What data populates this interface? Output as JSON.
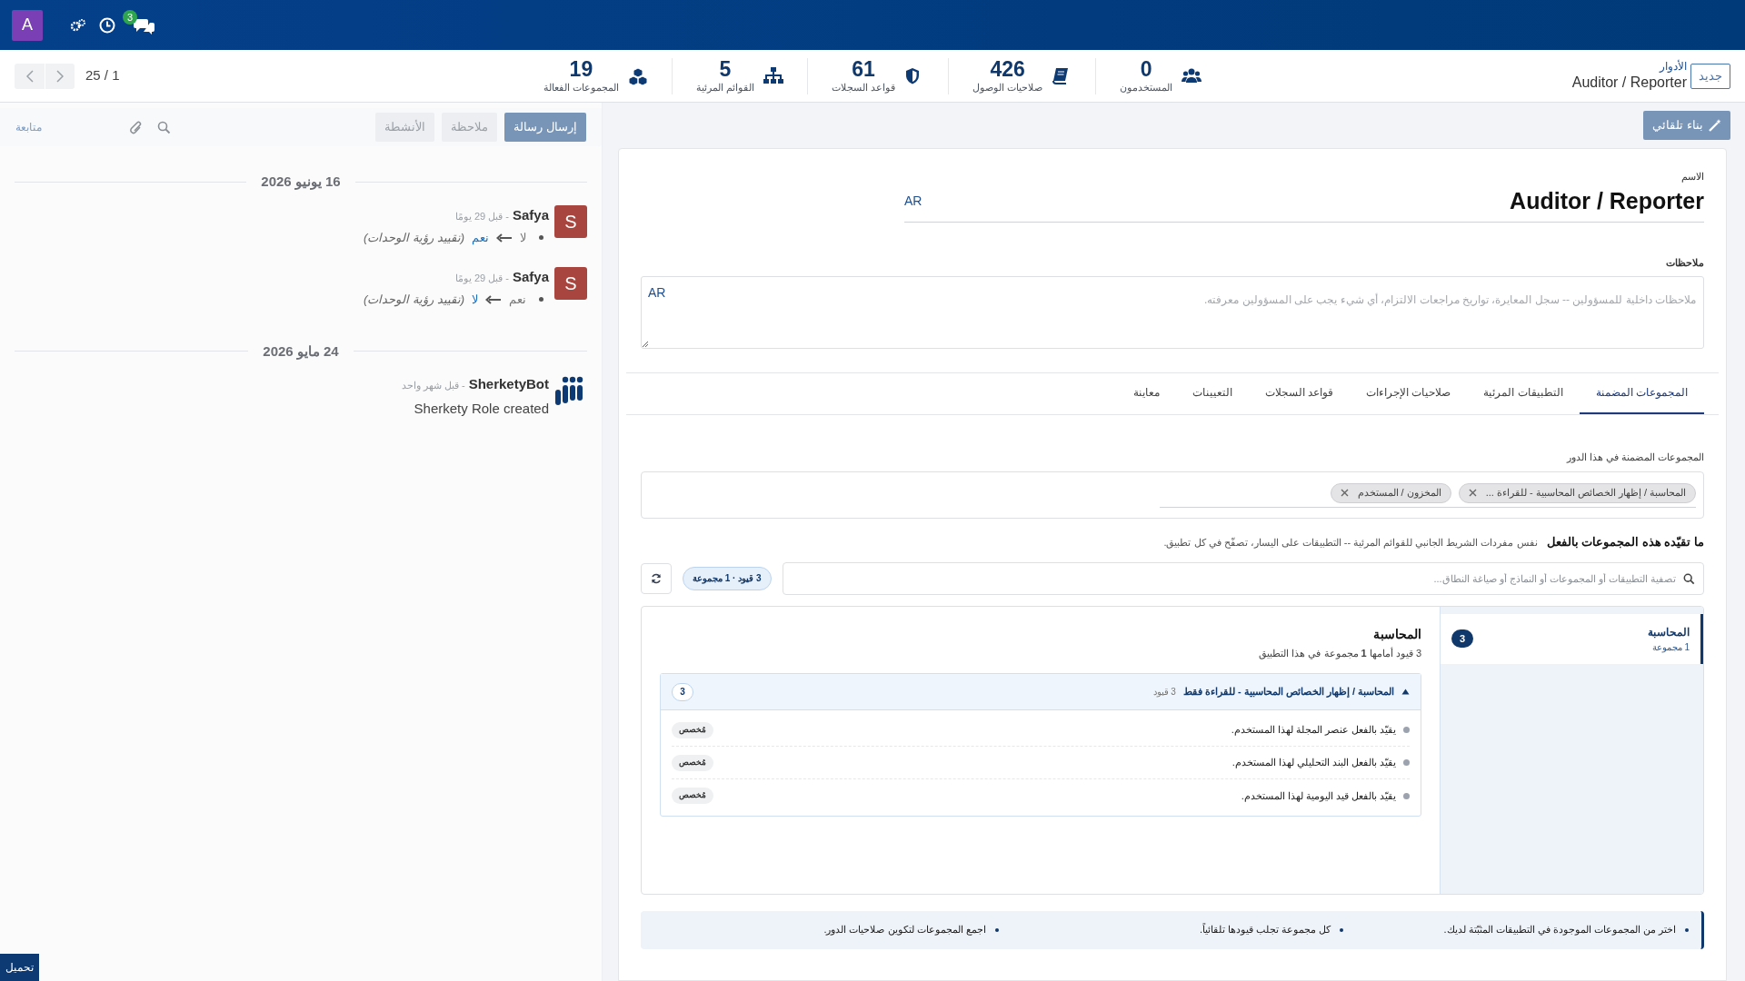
{
  "navbar": {
    "avatar": "A",
    "chat_badge": "3"
  },
  "control_panel": {
    "pager": "25 / 1",
    "breadcrumb_parent": "الأدوار",
    "breadcrumb_current": "Auditor / Reporter",
    "new_button": "جديد",
    "stats": [
      {
        "kind": "users",
        "value": "0",
        "label": "المستخدمون"
      },
      {
        "kind": "book",
        "value": "426",
        "label": "صلاحيات الوصول"
      },
      {
        "kind": "shield",
        "value": "61",
        "label": "قواعد السجلات"
      },
      {
        "kind": "sitemap",
        "value": "5",
        "label": "القوائم المرئية"
      },
      {
        "kind": "cubes",
        "value": "19",
        "label": "المجموعات الفعالة"
      }
    ]
  },
  "chatter": {
    "buttons": [
      {
        "label": "إرسال رسالة",
        "selected": true
      },
      {
        "label": "ملاحظة",
        "selected": false
      },
      {
        "label": "الأنشطة",
        "selected": false
      }
    ],
    "follow": "متابعة",
    "days": [
      {
        "date": "16 يونيو 2026",
        "messages": [
          {
            "kind": "tracking",
            "author": "Safya",
            "initial": "S",
            "time": "- قبل 29 يومًا",
            "old": "لا",
            "new": "نعم",
            "field": "(تقييد رؤية الوحدات)"
          },
          {
            "kind": "tracking",
            "author": "Safya",
            "initial": "S",
            "time": "- قبل 29 يومًا",
            "old": "نعم",
            "new": "لا",
            "field": "(تقييد رؤية الوحدات)"
          }
        ]
      },
      {
        "date": "24 مايو 2026",
        "messages": [
          {
            "kind": "bot",
            "author": "SherketyBot",
            "time": "- قبل شهر واحد",
            "body": "Sherkety Role created"
          }
        ]
      }
    ]
  },
  "download_button": "تحميل",
  "form": {
    "auto_build_button": "بناء تلقائي",
    "name_label": "الاسم",
    "name": "Auditor / Reporter",
    "name_lang": "AR",
    "notes_label": "ملاحظات",
    "notes_placeholder": "ملاحظات داخلية للمسؤولين -- سجل المعايرة، تواريخ مراجعات الالتزام، أي شيء يجب على المسؤولين معرفته.",
    "notes_lang": "AR",
    "tabs": [
      {
        "label": "المجموعات المضمنة",
        "selected": true
      },
      {
        "label": "التطبيقات المرئية",
        "selected": false
      },
      {
        "label": "صلاحيات الإجراءات",
        "selected": false
      },
      {
        "label": "قواعد السجلات",
        "selected": false
      },
      {
        "label": "التعيينات",
        "selected": false
      },
      {
        "label": "معاينة",
        "selected": false
      }
    ],
    "groups_label": "المجموعات المضمنة في هذا الدور",
    "tags": [
      "المحاسبة / إظهار الخصائص المحاسبية - للقراءة ...",
      "المخزون / المستخدم"
    ],
    "restrict_title": "ما تقيّده هذه المجموعات بالفعل",
    "restrict_hint": "نفس مفردات الشريط الجانبي للقوائم المرئية -- التطبيقات على اليسار، تصفّح في كل تطبيق.",
    "filter_placeholder": "تصفية التطبيقات أو المجموعات أو النماذج أو صياغة النطاق...",
    "summary_badge": "3 قيود · 1 مجموعة",
    "apps": [
      {
        "name": "المحاسبة",
        "groups": "1 مجموعة",
        "badge": "3",
        "selected": true
      }
    ],
    "app_title": "المحاسبة",
    "app_subtitle": "3 قيود أمامها **1** مجموعة في هذا التطبيق",
    "rule_groups": [
      {
        "title": "المحاسبة / إظهار الخصائص المحاسبية - للقراءة فقط",
        "count": "3 قيود",
        "badge": "3",
        "expanded": true,
        "rules": [
          {
            "text": "يقيّد بالفعل عنصر المجلة لهذا المستخدم.",
            "tag": "مُخصص"
          },
          {
            "text": "يقيّد بالفعل البند التحليلي لهذا المستخدم.",
            "tag": "مُخصص"
          },
          {
            "text": "يقيّد بالفعل قيد اليومية لهذا المستخدم.",
            "tag": "مُخصص"
          }
        ]
      }
    ],
    "tips": [
      "اختر من المجموعات الموجودة في التطبيقات المثبّتة لديك.",
      "كل مجموعة تجلب قيودها تلقائياً.",
      "اجمع المجموعات لتكوين صلاحيات الدور."
    ]
  }
}
